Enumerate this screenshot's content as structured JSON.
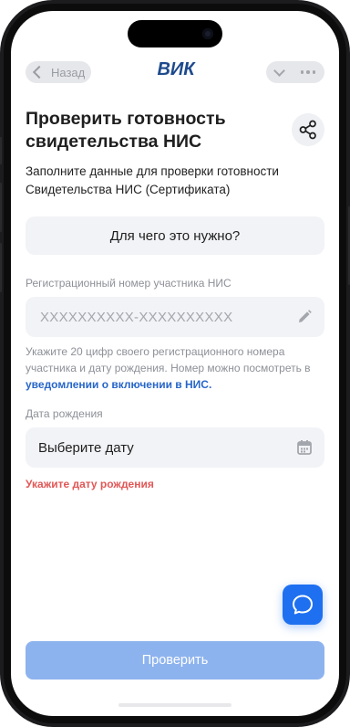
{
  "header": {
    "back_label": "Назад",
    "logo_text": "ВИК"
  },
  "page": {
    "title": "Проверить готовность свидетельства НИС",
    "subtitle": "Заполните данные для проверки готовности Свидетельства НИС (Сертификата)",
    "why_button": "Для чего это нужно?"
  },
  "form": {
    "reg_number": {
      "label": "Регистрационный номер участника НИС",
      "placeholder": "XXXXXXXXXX-XXXXXXXXXX",
      "value": "",
      "hint_text": "Укажите 20 цифр своего регистрационного номера участника и дату рождения. Номер можно посмотреть в ",
      "hint_link": "уведомлении о включении в НИС."
    },
    "birth_date": {
      "label": "Дата рождения",
      "value": "Выберите дату",
      "error": "Укажите дату рождения"
    },
    "submit_label": "Проверить"
  },
  "colors": {
    "accent": "#1e70f0",
    "submit_disabled": "#8db3ee",
    "error": "#e25757",
    "link": "#2766c9",
    "logo": "#1e4a8c"
  },
  "icons": {
    "back": "chevron-left-icon",
    "menu_collapse": "chevron-down-icon",
    "menu_more": "more-dots-icon",
    "share": "share-icon",
    "edit": "pencil-icon",
    "calendar": "calendar-icon",
    "chat": "chat-bubble-icon"
  }
}
